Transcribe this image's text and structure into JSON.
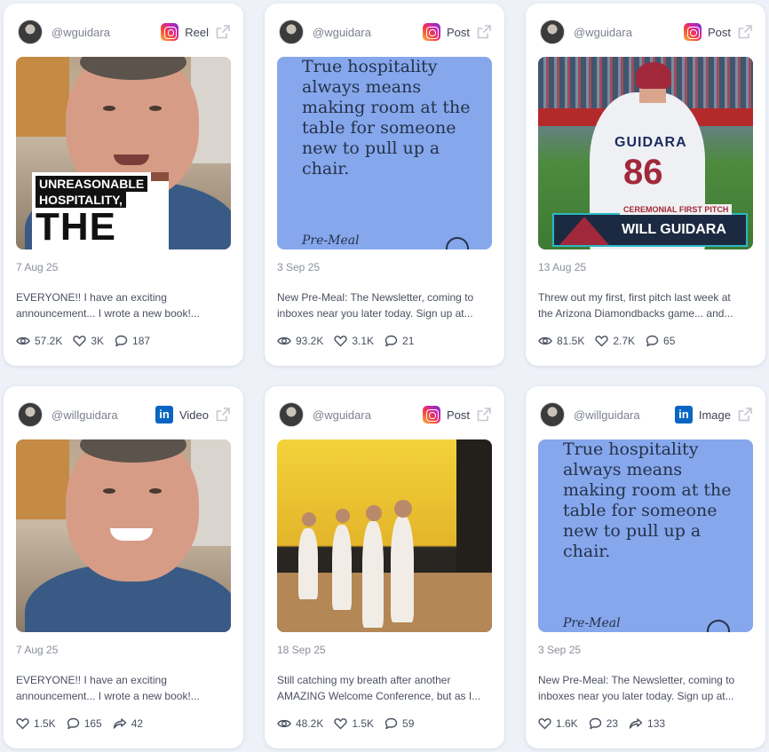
{
  "posts": [
    {
      "handle": "@wguidara",
      "platform": "instagram",
      "platform_label": "Reel",
      "date": "7 Aug 25",
      "caption": [
        "EVERYONE!! I have an exciting",
        "announcement... I wrote a new book!..."
      ],
      "media": {
        "type": "selfie-book",
        "overlay": [
          "UNREASONABLE",
          "HOSPITALITY,",
          "THE"
        ]
      },
      "stats": [
        {
          "icon": "eye-icon",
          "value": "57.2K"
        },
        {
          "icon": "heart-icon",
          "value": "3K"
        },
        {
          "icon": "comment-icon",
          "value": "187"
        }
      ]
    },
    {
      "handle": "@wguidara",
      "platform": "instagram",
      "platform_label": "Post",
      "date": "3 Sep 25",
      "caption": [
        "New Pre-Meal: The Newsletter, coming to",
        "inboxes near you later today. Sign up at..."
      ],
      "media": {
        "type": "quote",
        "quote": "True hospitality always means making room at the table for someone new to pull up a chair.",
        "signature": "Pre-Meal"
      },
      "stats": [
        {
          "icon": "eye-icon",
          "value": "93.2K"
        },
        {
          "icon": "heart-icon",
          "value": "3.1K"
        },
        {
          "icon": "comment-icon",
          "value": "21"
        }
      ]
    },
    {
      "handle": "@wguidara",
      "platform": "instagram",
      "platform_label": "Post",
      "date": "13 Aug 25",
      "caption": [
        "Threw out my first, first pitch last week at",
        "the Arizona Diamondbacks game... and..."
      ],
      "media": {
        "type": "baseball",
        "jersey_name": "GUIDARA",
        "jersey_number": "86",
        "lower_third_tag": "CEREMONIAL FIRST PITCH",
        "lower_third_name": "WILL GUIDARA"
      },
      "stats": [
        {
          "icon": "eye-icon",
          "value": "81.5K"
        },
        {
          "icon": "heart-icon",
          "value": "2.7K"
        },
        {
          "icon": "comment-icon",
          "value": "65"
        }
      ]
    },
    {
      "handle": "@willguidara",
      "platform": "linkedin",
      "platform_label": "Video",
      "date": "7 Aug 25",
      "caption": [
        "EVERYONE!! I have an exciting",
        "announcement... I wrote a new book!..."
      ],
      "media": {
        "type": "selfie-smile"
      },
      "stats": [
        {
          "icon": "heart-icon",
          "value": "1.5K"
        },
        {
          "icon": "comment-icon",
          "value": "165"
        },
        {
          "icon": "share-icon",
          "value": "42"
        }
      ]
    },
    {
      "handle": "@wguidara",
      "platform": "instagram",
      "platform_label": "Post",
      "date": "18 Sep 25",
      "caption": [
        "Still catching my breath after another",
        "AMAZING Welcome Conference, but as I..."
      ],
      "media": {
        "type": "conference"
      },
      "stats": [
        {
          "icon": "eye-icon",
          "value": "48.2K"
        },
        {
          "icon": "heart-icon",
          "value": "1.5K"
        },
        {
          "icon": "comment-icon",
          "value": "59"
        }
      ]
    },
    {
      "handle": "@willguidara",
      "platform": "linkedin",
      "platform_label": "Image",
      "date": "3 Sep 25",
      "caption": [
        "New Pre-Meal: The Newsletter, coming to",
        "inboxes near you later today. Sign up at..."
      ],
      "media": {
        "type": "quote",
        "quote": "True hospitality always means making room at the table for someone new to pull up a chair.",
        "signature": "Pre-Meal"
      },
      "stats": [
        {
          "icon": "heart-icon",
          "value": "1.6K"
        },
        {
          "icon": "comment-icon",
          "value": "23"
        },
        {
          "icon": "share-icon",
          "value": "133"
        }
      ]
    }
  ]
}
